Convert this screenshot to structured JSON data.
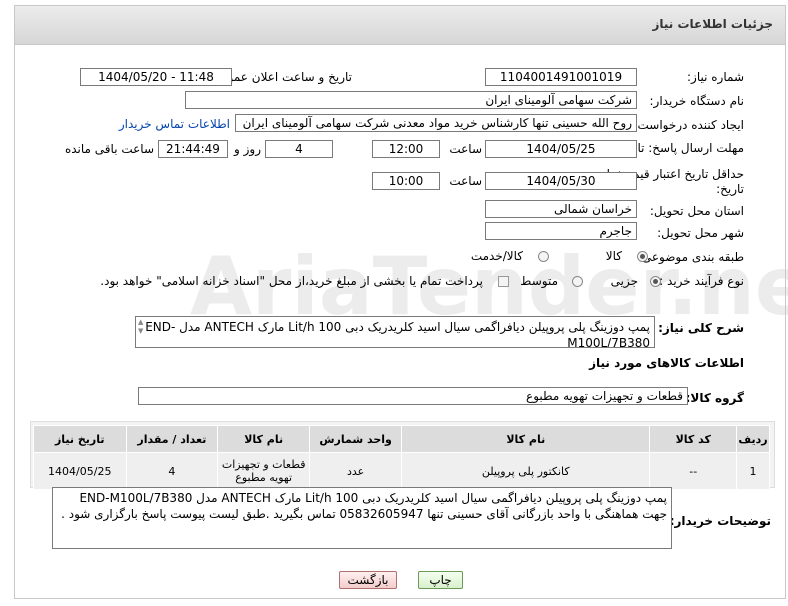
{
  "header": {
    "title": "جزئیات اطلاعات نیاز"
  },
  "fields": {
    "need_number_label": "شماره نیاز:",
    "need_number": "1104001491001019",
    "announce_label": "تاریخ و ساعت اعلان عمومی:",
    "announce_value": "1404/05/20 - 11:48",
    "buyer_org_label": "نام دستگاه خریدار:",
    "buyer_org": "شرکت سهامی آلومینای ایران",
    "creator_label": "ایجاد کننده درخواست:",
    "creator": "روح الله حسینی تنها کارشناس خرید مواد معدنی شرکت سهامی آلومینای ایران",
    "buyer_contact_link": "اطلاعات تماس خریدار",
    "reply_deadline_label": "مهلت ارسال پاسخ: تا تاریخ:",
    "reply_date": "1404/05/25",
    "time_label": "ساعت",
    "reply_time": "12:00",
    "days_value": "4",
    "days_label": "روز و",
    "remaining_time": "21:44:49",
    "remaining_label": "ساعت باقی مانده",
    "price_validity_label": "حداقل تاریخ اعتبار قیمت: تا تاریخ:",
    "price_date": "1404/05/30",
    "price_time": "10:00",
    "province_label": "استان محل تحویل:",
    "province": "خراسان شمالی",
    "city_label": "شهر محل تحویل:",
    "city": "جاجرم",
    "category_label": "طبقه بندی موضوعی:",
    "category_options": [
      "کالا",
      "کالا/خدمت"
    ],
    "process_label": "نوع فرآیند خرید :",
    "process_options": [
      "جزیی",
      "متوسط"
    ],
    "payment_note": "پرداخت تمام یا بخشی از مبلغ خرید،از محل \"اسناد خزانه اسلامی\" خواهد بود.",
    "summary_label": "شرح کلی نیاز:",
    "summary": "پمپ دوزینگ پلی پروپیلن دیافراگمی سیال اسید کلریدریک دبی 100 Lit/h مارک ANTECH مدل END-M100L/7B380"
  },
  "goods": {
    "section_title": "اطلاعات کالاهای مورد نیاز",
    "group_label": "گروه کالا:",
    "group_value": "قطعات و تجهیزات تهویه مطبوع",
    "columns": [
      "ردیف",
      "کد کالا",
      "نام کالا",
      "واحد شمارش",
      "نام کالا",
      "تعداد / مقدار",
      "تاریخ نیاز"
    ],
    "rows": [
      {
        "index": "1",
        "code": "--",
        "name": "کانکتور پلی پروپیلن",
        "unit": "عدد",
        "group": "قطعات و تجهیزات تهویه مطبوع",
        "qty": "4",
        "date": "1404/05/25"
      }
    ]
  },
  "buyer_notes": {
    "label": "توضیحات خریدار:",
    "text": "پمپ دوزینگ پلی پروپیلن دیافراگمی سیال اسید کلریدریک دبی 100 Lit/h مارک ANTECH مدل END-M100L/7B380 جهت هماهنگی با واحد بازرگانی آقای حسینی تنها 05832605947 تماس بگیرید .طبق لیست پیوست پاسخ بارگزاری شود ."
  },
  "buttons": {
    "print": "چاپ",
    "back": "بازگشت"
  },
  "watermark": "AriaTender.net"
}
